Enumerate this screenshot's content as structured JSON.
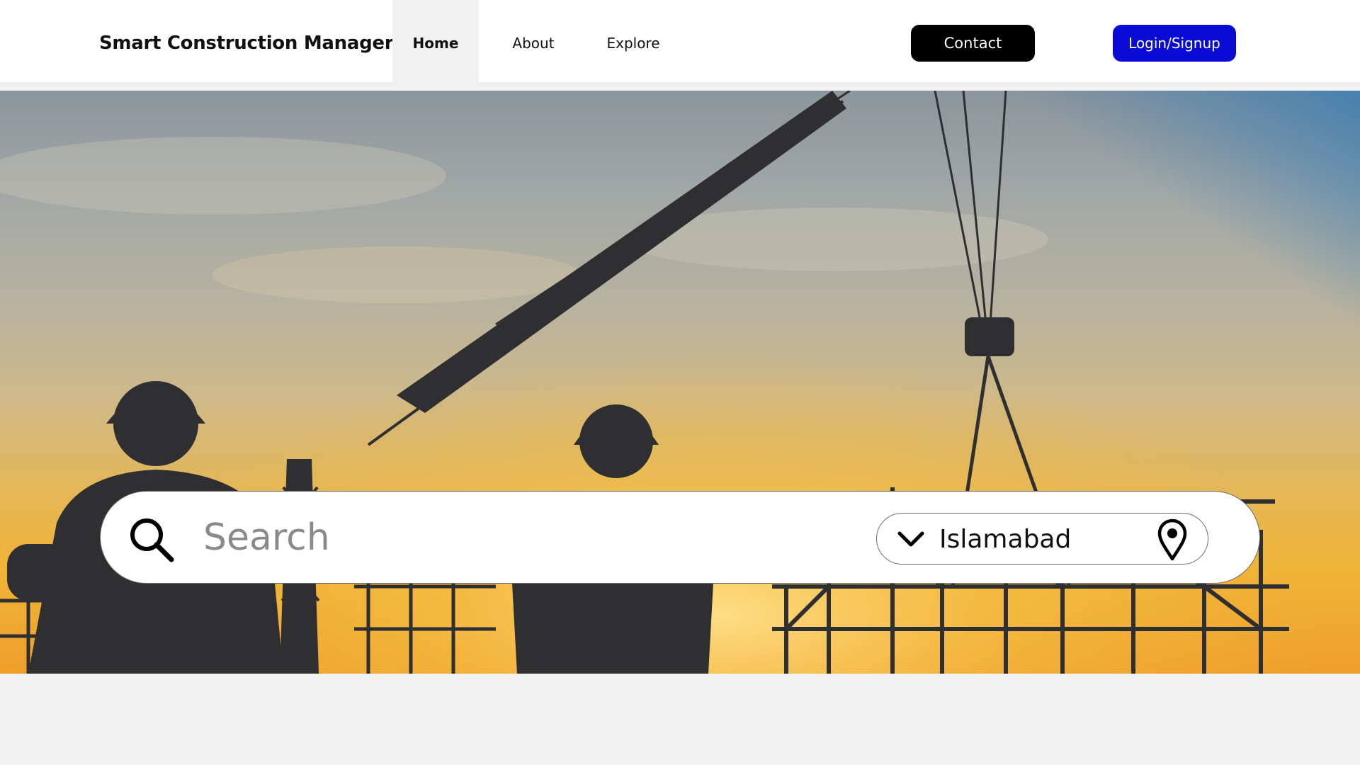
{
  "header": {
    "brand": "Smart Construction Manager",
    "nav": {
      "home": "Home",
      "about": "About",
      "explore": "Explore"
    },
    "active_nav": "Home",
    "contact_label": "Contact",
    "login_label": "Login/Signup"
  },
  "hero": {
    "image_subject": "construction site silhouette at sunset"
  },
  "search": {
    "placeholder": "Search",
    "value": "",
    "location": "Islamabad",
    "icons": [
      "search-icon",
      "chevron-down-icon",
      "map-pin-icon"
    ]
  },
  "colors": {
    "login_button": "#0a0ad6",
    "contact_button": "#000000",
    "page_background": "#f2f2f2",
    "active_nav_background": "#f1f1f1"
  }
}
